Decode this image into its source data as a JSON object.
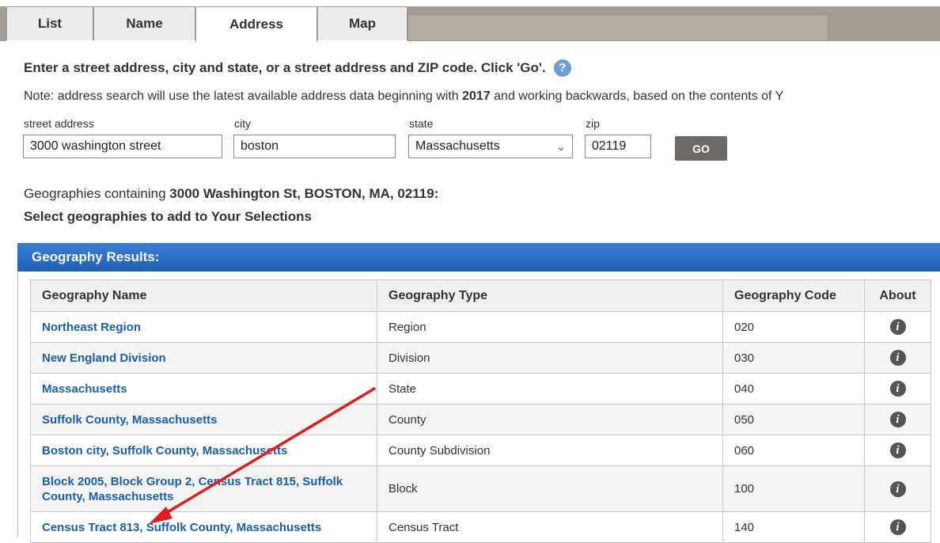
{
  "tabs": [
    {
      "label": "List"
    },
    {
      "label": "Name"
    },
    {
      "label": "Address"
    },
    {
      "label": "Map"
    }
  ],
  "instruction": "Enter a street address, city and state, or a street address and ZIP code. Click 'Go'.",
  "help_icon": "question-icon",
  "note": {
    "prefix": "Note: address search will use the latest available address data beginning with ",
    "year": "2017",
    "suffix": " and working backwards, based on the contents of Y"
  },
  "form": {
    "street_label": "street address",
    "street_value": "3000 washington street",
    "city_label": "city",
    "city_value": "boston",
    "state_label": "state",
    "state_value": "Massachusetts",
    "zip_label": "zip",
    "zip_value": "02119",
    "go_label": "GO"
  },
  "contains": {
    "prefix": "Geographies containing ",
    "address": "3000 Washington St, BOSTON, MA, 02119:"
  },
  "select_text": "Select geographies to add to Your Selections",
  "results": {
    "header": "Geography Results:",
    "columns": [
      "Geography Name",
      "Geography Type",
      "Geography Code",
      "About"
    ],
    "rows": [
      {
        "name": "Northeast Region",
        "type": "Region",
        "code": "020"
      },
      {
        "name": "New England Division",
        "type": "Division",
        "code": "030"
      },
      {
        "name": "Massachusetts",
        "type": "State",
        "code": "040"
      },
      {
        "name": "Suffolk County, Massachusetts",
        "type": "County",
        "code": "050"
      },
      {
        "name": "Boston city, Suffolk County, Massachusetts",
        "type": "County Subdivision",
        "code": "060"
      },
      {
        "name": "Block 2005, Block Group 2, Census Tract 815, Suffolk County, Massachusetts",
        "type": "Block",
        "code": "100"
      },
      {
        "name": "Census Tract 813, Suffolk County, Massachusetts",
        "type": "Census Tract",
        "code": "140"
      }
    ],
    "about_icon": "i"
  },
  "colors": {
    "header_blue": "#1f5fb4",
    "link_blue": "#1a5fae",
    "annotation_red": "#e01c1c"
  }
}
